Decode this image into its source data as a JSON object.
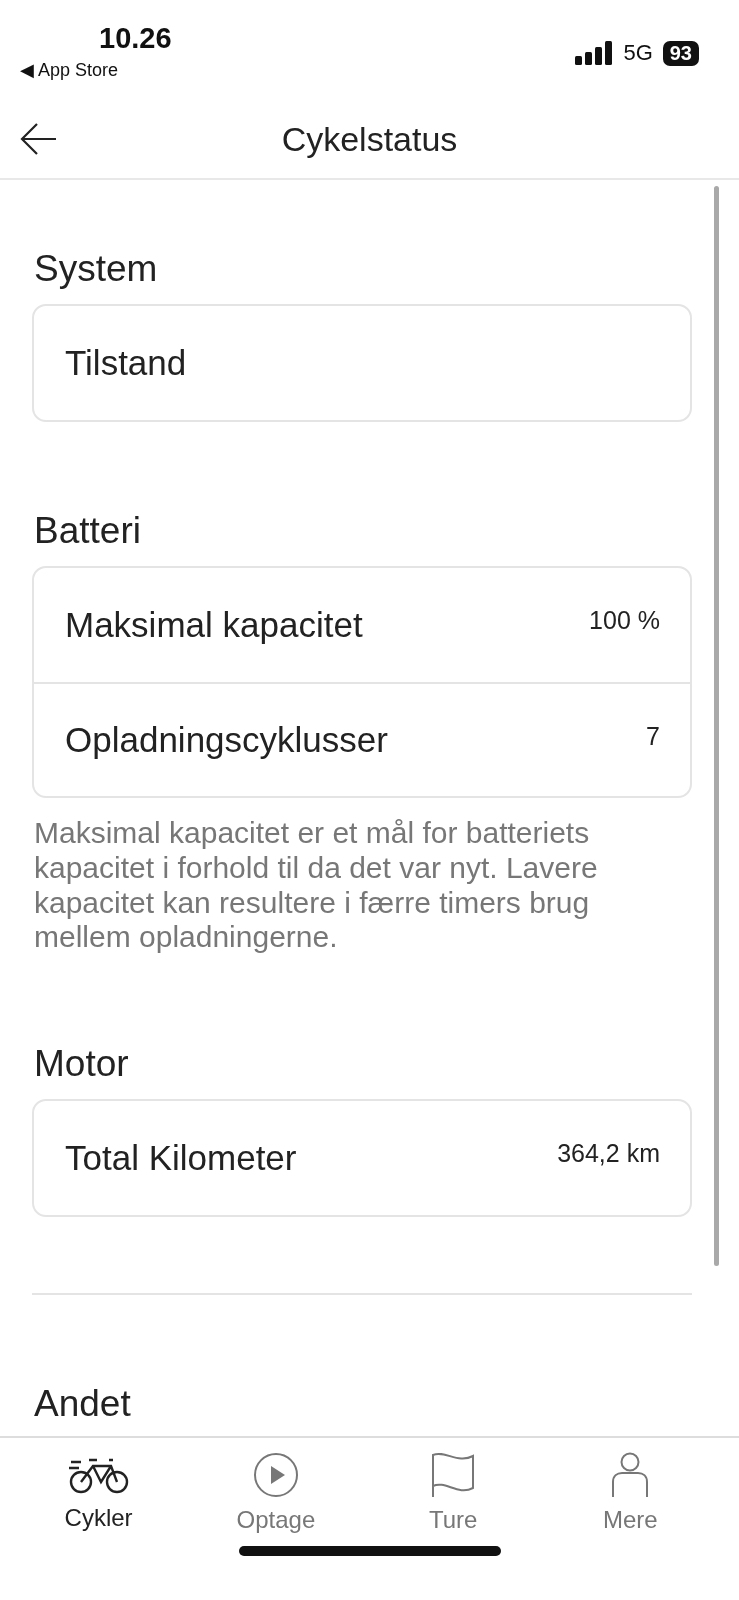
{
  "status_bar": {
    "time": "10.26",
    "back_label": "◀ App Store",
    "network": "5G",
    "battery": "93"
  },
  "header": {
    "title": "Cykelstatus"
  },
  "sections": [
    {
      "title": "System",
      "rows": [
        {
          "label": "Tilstand"
        }
      ]
    },
    {
      "title": "Batteri",
      "rows": [
        {
          "label": "Maksimal kapacitet",
          "value": "100 %"
        },
        {
          "label": "Opladningscyklusser",
          "value": "7"
        }
      ],
      "note": "Maksimal kapacitet er et mål for batteriets kapacitet i forhold til da det var nyt. Lavere kapacitet kan resultere i færre timers brug mellem opladningerne."
    },
    {
      "title": "Motor",
      "rows": [
        {
          "label": "Total Kilometer",
          "value": "364,2 km"
        }
      ]
    }
  ],
  "other_section": {
    "title": "Andet"
  },
  "tab_bar": [
    {
      "label": "Cykler",
      "kind": "bike",
      "selected": true
    },
    {
      "label": "Optage",
      "kind": "play",
      "selected": false
    },
    {
      "label": "Ture",
      "kind": "flag",
      "selected": false
    },
    {
      "label": "Mere",
      "kind": "person",
      "selected": false
    }
  ]
}
